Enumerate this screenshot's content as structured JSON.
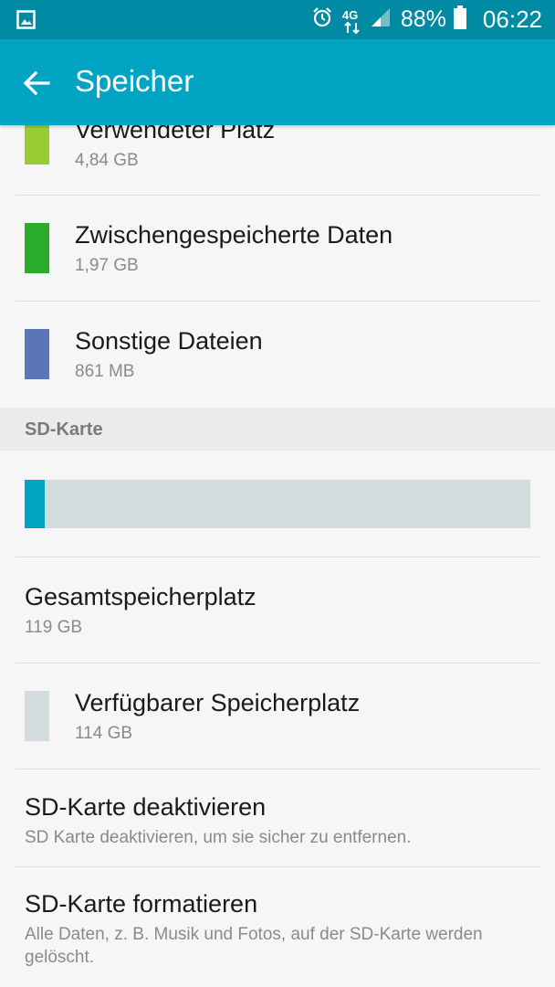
{
  "status_bar": {
    "network": "4G",
    "battery_percent": "88%",
    "time": "06:22",
    "icons": [
      "image-icon",
      "alarm-icon",
      "network-4g-icon",
      "signal-icon",
      "battery-icon"
    ]
  },
  "app_bar": {
    "title": "Speicher",
    "back_icon": "arrow-left-icon"
  },
  "colors": {
    "status_bar": "#008aa3",
    "app_bar": "#02a4c4",
    "used_space": "#99cc33",
    "cached_data": "#2aac2a",
    "other_files": "#5a75b8",
    "available": "#d3dcdd"
  },
  "internal_items": [
    {
      "title": "Verwendeter Platz",
      "value": "4,84 GB"
    },
    {
      "title": "Zwischengespeicherte Daten",
      "value": "1,97 GB"
    },
    {
      "title": "Sonstige Dateien",
      "value": "861 MB"
    }
  ],
  "sd_card": {
    "section_title": "SD-Karte",
    "usage_fraction": 0.04,
    "total": {
      "title": "Gesamtspeicherplatz",
      "value": "119 GB"
    },
    "available": {
      "title": "Verfügbarer Speicherplatz",
      "value": "114 GB"
    },
    "unmount": {
      "title": "SD-Karte deaktivieren",
      "description": "SD Karte deaktivieren, um sie sicher zu entfernen."
    },
    "format": {
      "title": "SD-Karte formatieren",
      "description_line1": "Alle Daten, z. B. Musik und Fotos, auf der SD-Karte werden",
      "description_line2": "gelöscht."
    }
  }
}
